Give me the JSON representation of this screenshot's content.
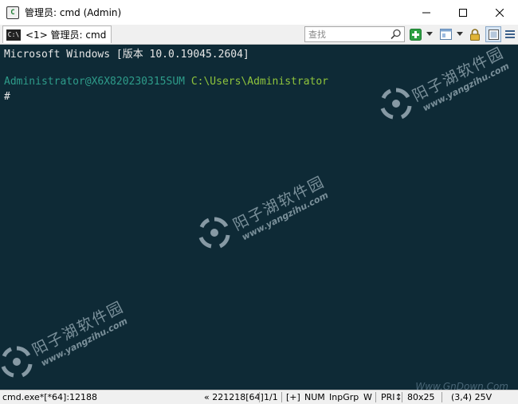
{
  "window": {
    "title": "管理员: cmd (Admin)",
    "app_icon_glyph": "C"
  },
  "tabs": [
    {
      "label": "<1> 管理员: cmd",
      "icon_glyph": "C:\\"
    }
  ],
  "toolbar": {
    "search_placeholder": "查找"
  },
  "console": {
    "lines": [
      {
        "text": "Microsoft Windows [版本 10.0.19045.2604]"
      },
      {
        "prompt": "Administrator@X6X820230315SUM",
        "path": "C:\\Users\\Administrator"
      },
      {
        "text": "#"
      }
    ],
    "colors": {
      "background": "#0e2a36",
      "text": "#e6e6e6",
      "prompt": "#2e9c8a",
      "path": "#8fc43c"
    }
  },
  "watermarks": [
    {
      "title": "阳子湖软件园",
      "url": "www.yangzihu.com"
    },
    {
      "title": "阳子湖软件园",
      "url": "www.yangzihu.com"
    },
    {
      "title": "阳子湖软件园",
      "url": "www.yangzihu.com"
    }
  ],
  "corner_watermark": "Www.GnDown.Com",
  "statusbar": {
    "process": "cmd.exe*[*64]:12188",
    "pid_info": "« 221218[64]",
    "console_index": "1/1",
    "plus": "[+]",
    "num": "NUM",
    "inpgrp": "InpGrp",
    "w": "W",
    "pri": "PRI↕",
    "size": "80x25",
    "cursor": "(3,4) 25V"
  }
}
